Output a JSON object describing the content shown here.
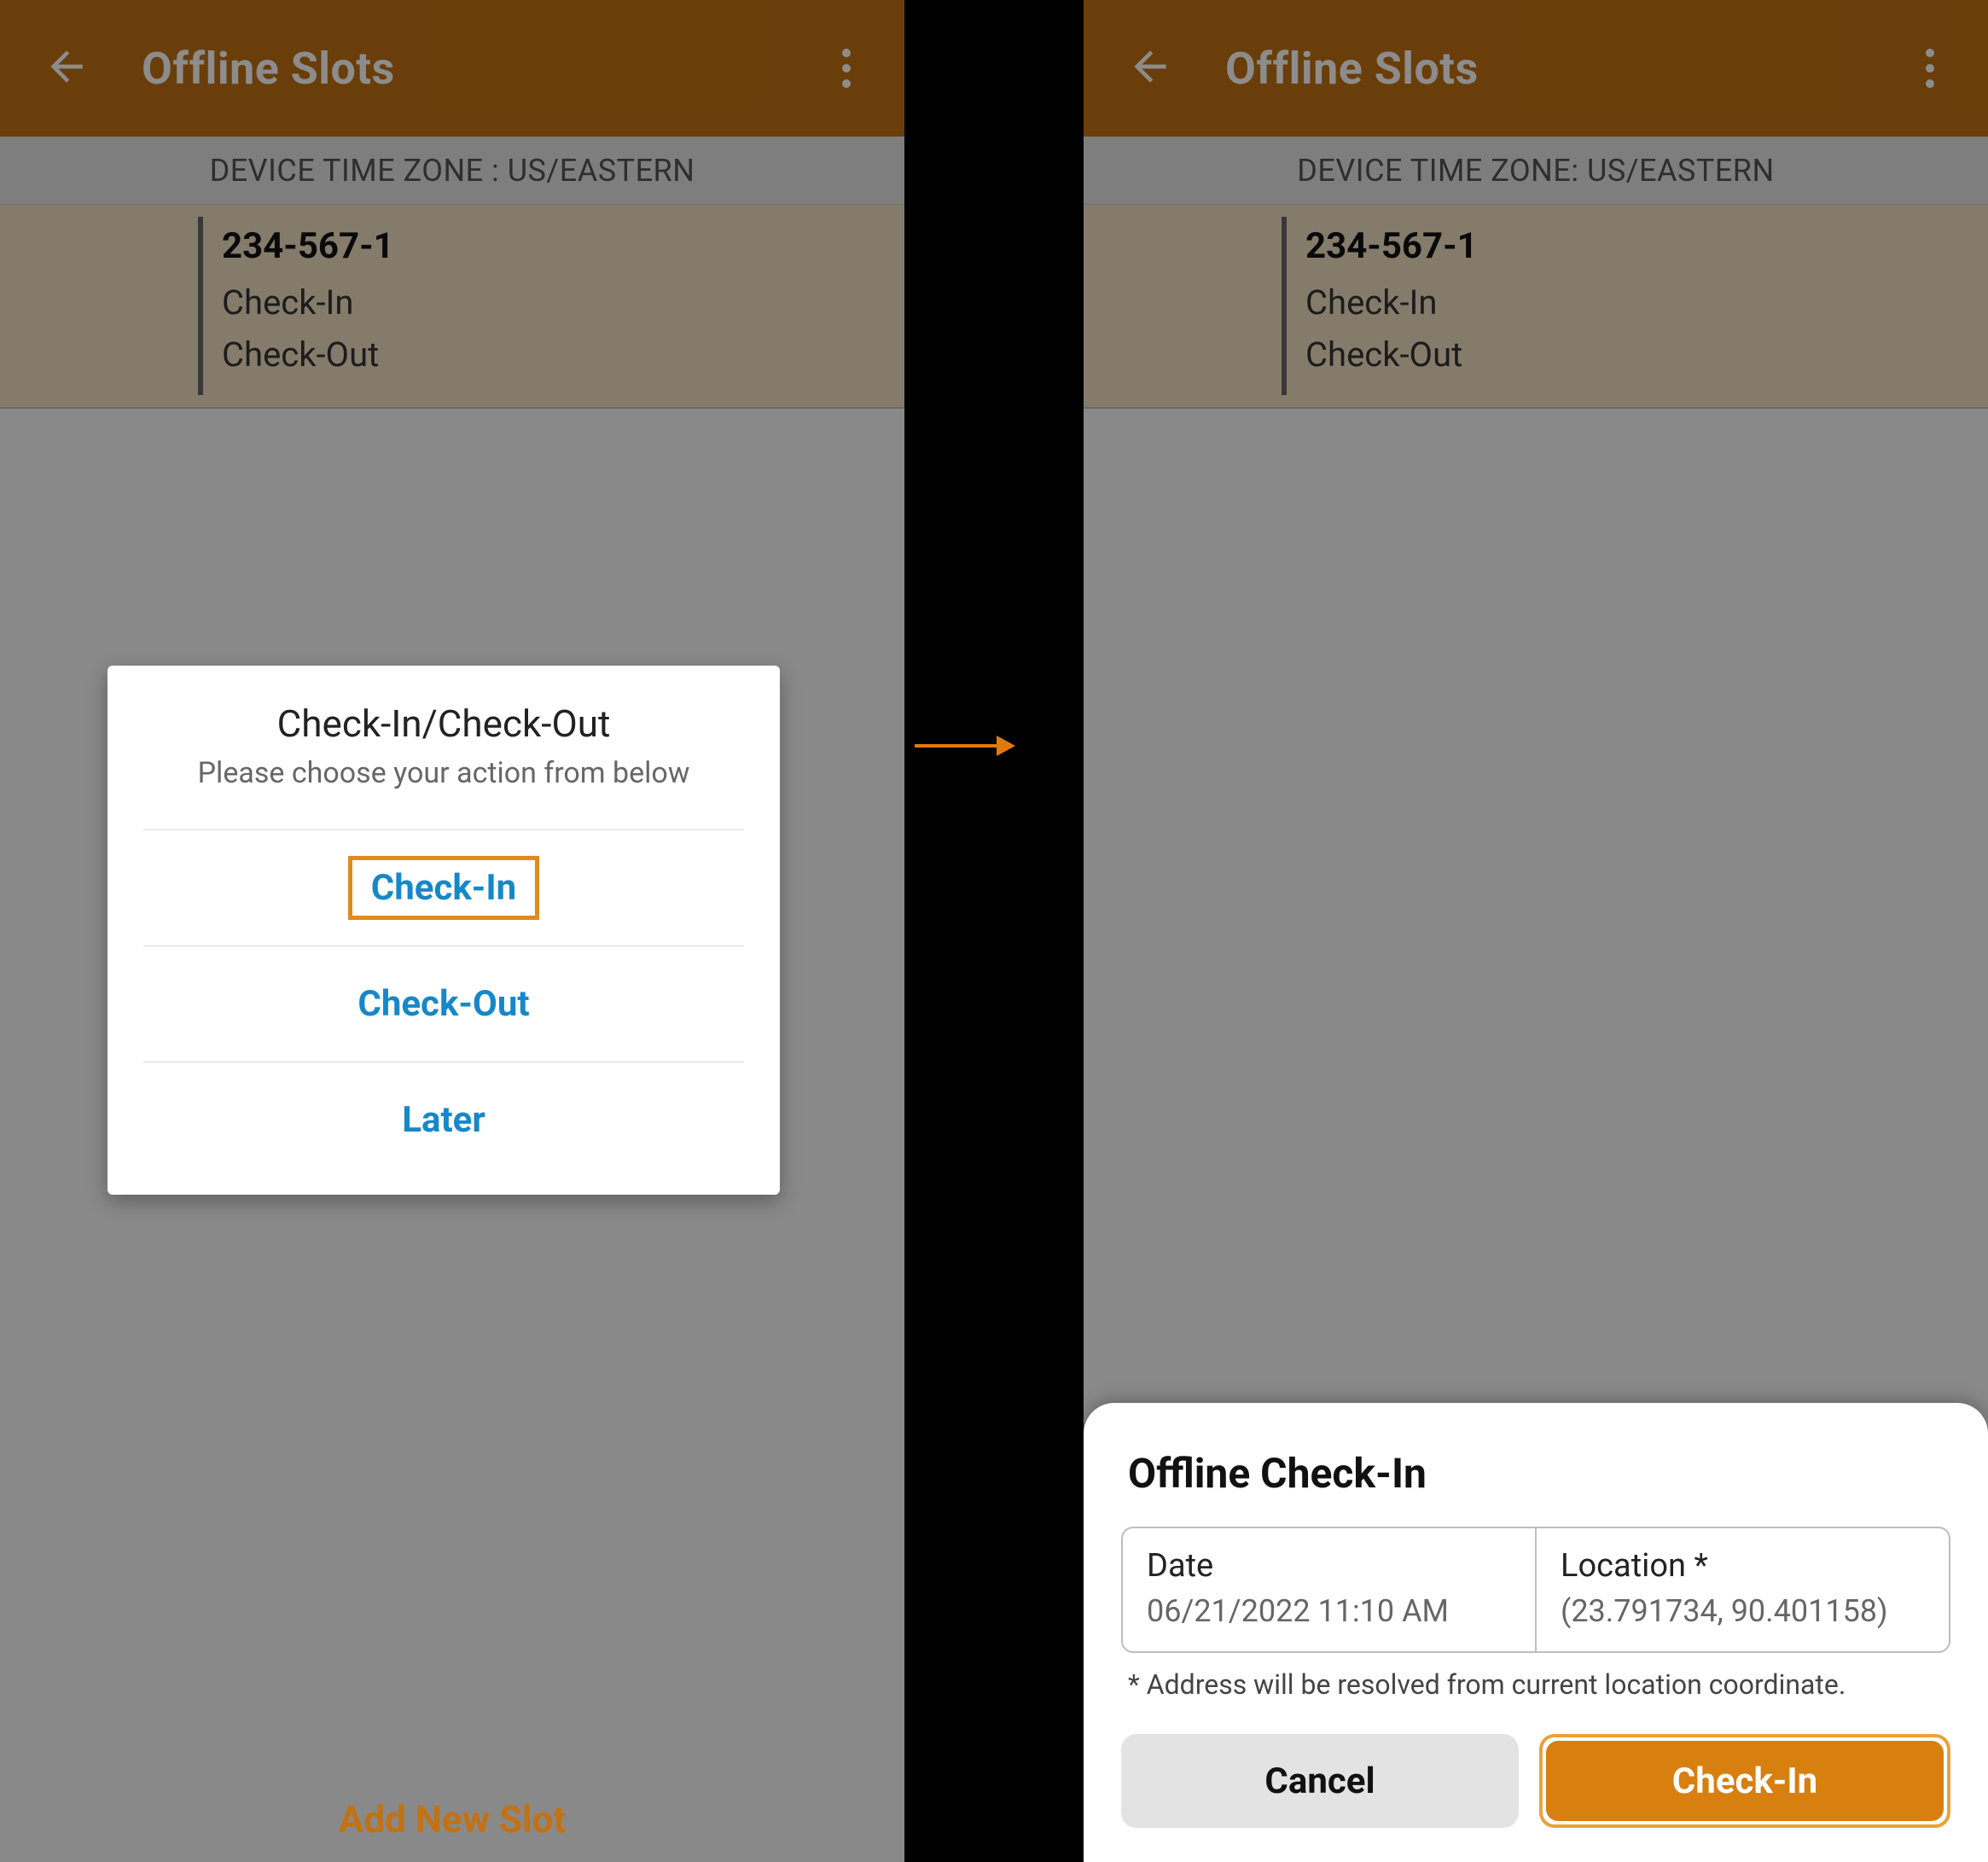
{
  "appbar": {
    "title": "Offline Slots"
  },
  "tz_bar_left": "DEVICE TIME ZONE : US/EASTERN",
  "tz_bar_right": "DEVICE TIME ZONE:  US/EASTERN",
  "slot": {
    "title": "234-567-1",
    "line1": "Check-In",
    "line2": "Check-Out"
  },
  "dialog": {
    "title": "Check-In/Check-Out",
    "subtitle": "Please choose your action from below",
    "options": {
      "checkin": "Check-In",
      "checkout": "Check-Out",
      "later": "Later"
    }
  },
  "add_slot": "Add New Slot",
  "sheet": {
    "title": "Offline Check-In",
    "date_label": "Date",
    "date_value": "06/21/2022 11:10 AM",
    "loc_label": "Location *",
    "loc_value": "(23.791734, 90.401158)",
    "note": "* Address will be resolved from current location coordinate.",
    "cancel": "Cancel",
    "checkin": "Check-In"
  }
}
